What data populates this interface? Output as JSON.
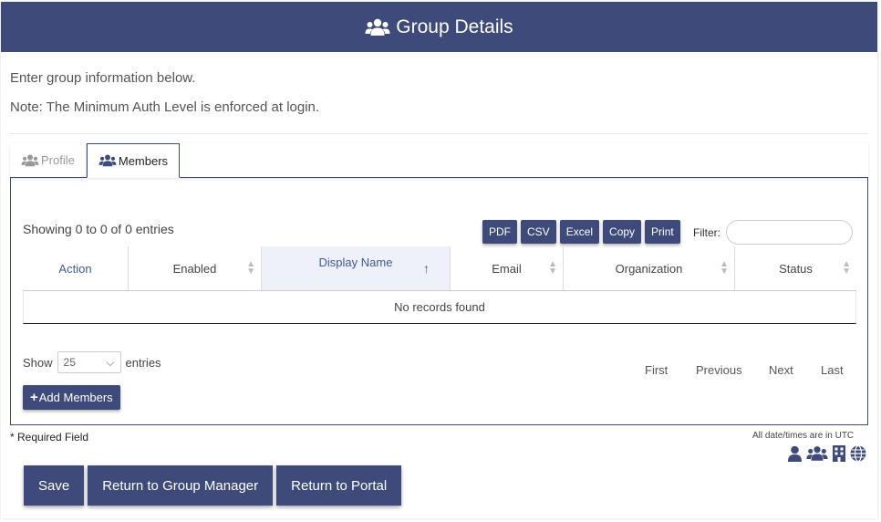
{
  "header": {
    "title": "Group Details",
    "icon": "users-icon"
  },
  "intro": {
    "line1": "Enter group information below.",
    "line2": "Note: The Minimum Auth Level is enforced at login."
  },
  "tabs": [
    {
      "label": "Profile",
      "icon": "users-icon",
      "active": false
    },
    {
      "label": "Members",
      "icon": "users-icon",
      "active": true
    }
  ],
  "table_info": {
    "showing": "Showing 0 to 0 of 0 entries"
  },
  "export_buttons": [
    "PDF",
    "CSV",
    "Excel",
    "Copy",
    "Print"
  ],
  "filter": {
    "label": "Filter:",
    "value": ""
  },
  "columns": [
    {
      "label": "Action"
    },
    {
      "label": "Enabled"
    },
    {
      "label": "Display Name",
      "sorted": "ascending"
    },
    {
      "label": "Email"
    },
    {
      "label": "Organization"
    },
    {
      "label": "Status"
    }
  ],
  "empty_message": "No records found",
  "length": {
    "show_label": "Show",
    "value": "25",
    "entries_label": "entries"
  },
  "pagination": {
    "first": "First",
    "previous": "Previous",
    "next": "Next",
    "last": "Last"
  },
  "add_members_label": "Add Members",
  "required_note": "* Required Field",
  "utc_note": "All date/times are in UTC",
  "legend_icons": [
    "user-icon",
    "users-icon",
    "building-icon",
    "globe-icon"
  ],
  "actions": {
    "save": "Save",
    "return_group": "Return to Group Manager",
    "return_portal": "Return to Portal"
  },
  "colors": {
    "primary": "#3d4a7a",
    "link": "#3d5a99"
  }
}
